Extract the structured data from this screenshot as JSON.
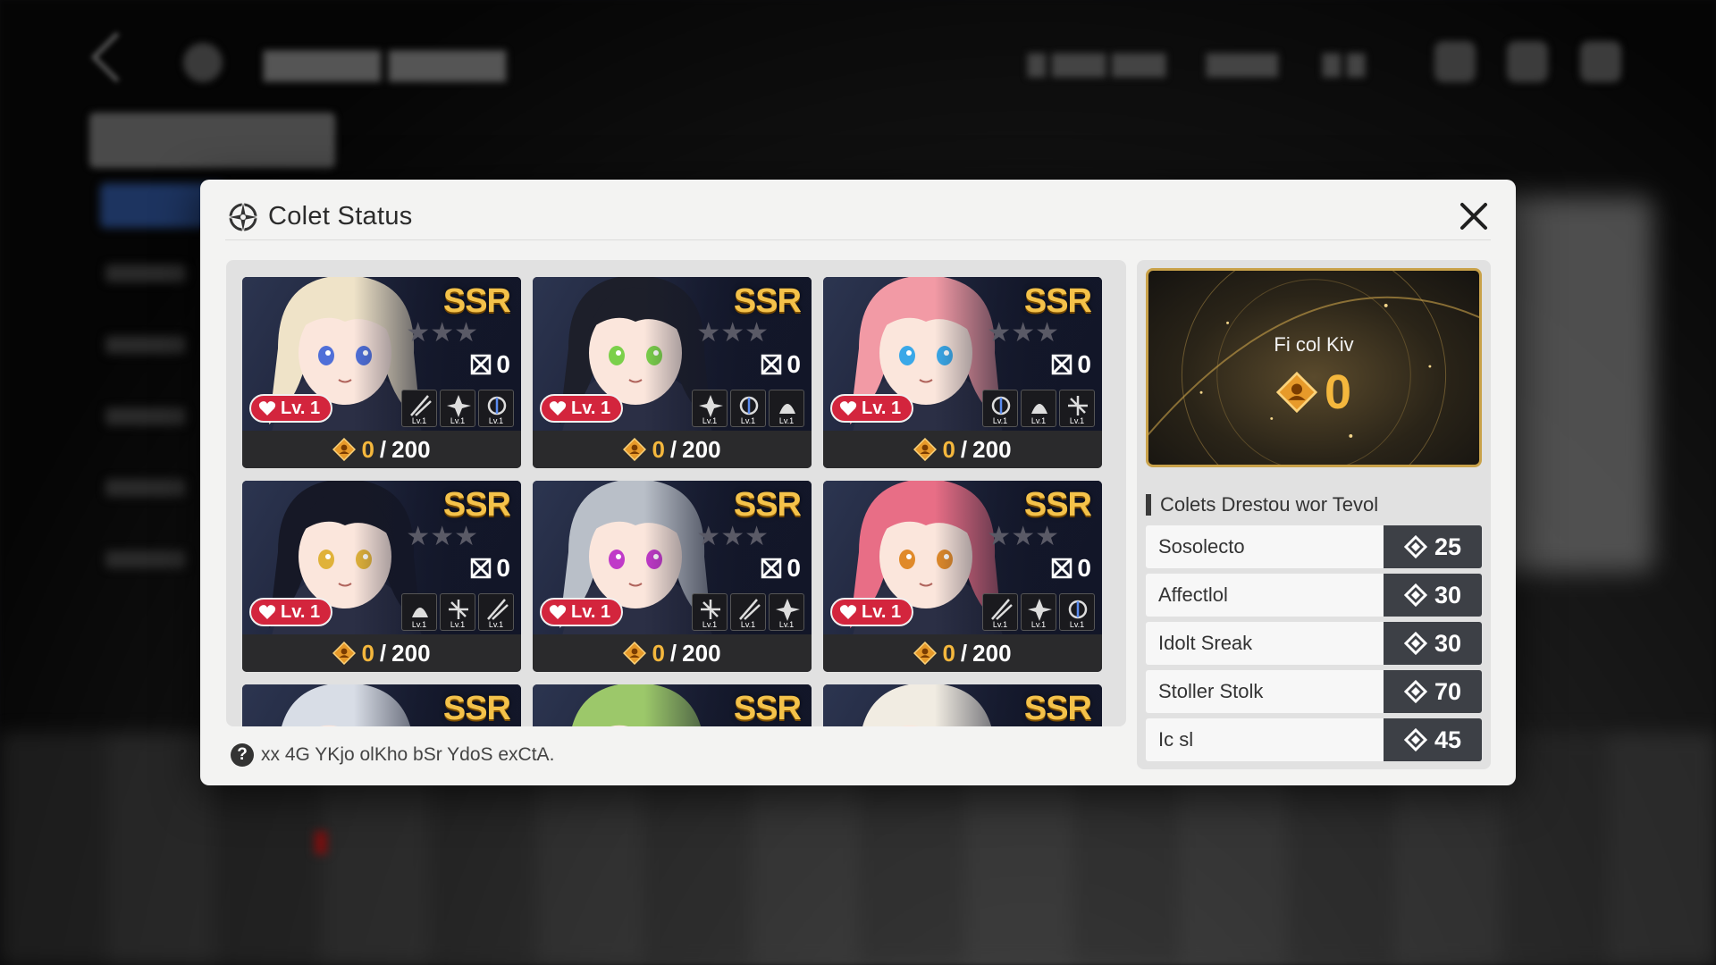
{
  "dialog": {
    "title": "Colet Status",
    "hint": "xx 4G YKjo olKho bSr YdoS exCtA."
  },
  "card_labels": {
    "rarity": "SSR",
    "level": "Lv. 1",
    "skill_level": "Lv.1",
    "separator": "/"
  },
  "cards": [
    {
      "shards": "0",
      "progress_current": "0",
      "progress_max": "200",
      "hair": "#efe3c8",
      "eyes": "#4f6fd8"
    },
    {
      "shards": "0",
      "progress_current": "0",
      "progress_max": "200",
      "hair": "#1d1f2a",
      "eyes": "#7bd04a"
    },
    {
      "shards": "0",
      "progress_current": "0",
      "progress_max": "200",
      "hair": "#f29aa5",
      "eyes": "#3aa8e8"
    },
    {
      "shards": "0",
      "progress_current": "0",
      "progress_max": "200",
      "hair": "#161826",
      "eyes": "#e0b23a"
    },
    {
      "shards": "0",
      "progress_current": "0",
      "progress_max": "200",
      "hair": "#b9bfc8",
      "eyes": "#c03ac8"
    },
    {
      "shards": "0",
      "progress_current": "0",
      "progress_max": "200",
      "hair": "#e86e86",
      "eyes": "#e08a2a"
    }
  ],
  "partial_cards": [
    {
      "hair": "#d8dde6"
    },
    {
      "hair": "#9cc86a"
    },
    {
      "hair": "#f1ece2"
    }
  ],
  "currency": {
    "label": "Fi col Kiv",
    "value": "0"
  },
  "costs": {
    "heading": "Colets Drestou wor Tevol",
    "items": [
      {
        "name": "Sosolecto",
        "value": "25"
      },
      {
        "name": "Affectlol",
        "value": "30"
      },
      {
        "name": "Idolt Sreak",
        "value": "30"
      },
      {
        "name": "Stoller Stolk",
        "value": "70"
      },
      {
        "name": "Ic sl",
        "value": "45"
      }
    ]
  },
  "colors": {
    "rarity_gold": "#f4c24a",
    "level_red": "#d3253d",
    "currency_gold": "#f4b73d",
    "modal_bg": "#f3f3f2"
  }
}
